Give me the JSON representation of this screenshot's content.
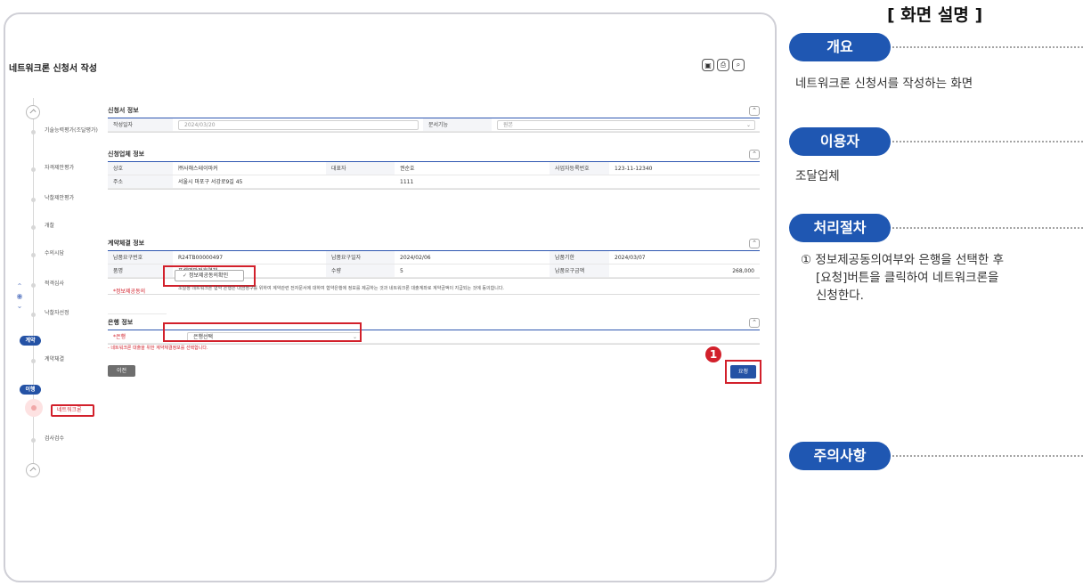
{
  "panel": {
    "title": "[ 화면 설명 ]",
    "overview_label": "개요",
    "overview_text": "네트워크론 신청서를 작성하는 화면",
    "user_label": "이용자",
    "user_text": "조달업체",
    "procedure_label": "처리절차",
    "procedure_line1": "① 정보제공동의여부와 은행을 선택한 후",
    "procedure_line2": "[요청]버튼을 클릭하여 네트워크론을",
    "procedure_line3": "신청한다.",
    "caution_label": "주의사항"
  },
  "screen": {
    "title": "네트워크론 신청서 작성",
    "toolbar_icons": [
      "save-icon",
      "print-icon",
      "zoom-icon"
    ],
    "steps": [
      {
        "label": "기술능력평가(조달평가)"
      },
      {
        "label": "자격제안평가"
      },
      {
        "label": "낙찰제안평가"
      },
      {
        "label": "개찰"
      },
      {
        "label": "수의시담"
      },
      {
        "label": "적격심사"
      },
      {
        "label": "낙찰자선정"
      },
      {
        "label": "계약체결"
      },
      {
        "label": "네트워크론"
      },
      {
        "label": "검사검수"
      }
    ],
    "stages": {
      "contract": "계약",
      "performance": "이행"
    },
    "application": {
      "header": "신청서 정보",
      "date_label": "작성일자",
      "date_value": "2024/03/20",
      "doc_label": "문서기능",
      "doc_value": "원본"
    },
    "company": {
      "header": "신청업체 정보",
      "name_label": "상호",
      "name_value": "㈜사해스테이마커",
      "rep_label": "대표자",
      "rep_value": "권순호",
      "bizno_label": "사업자등록번호",
      "bizno_value": "123-11-12340",
      "addr_label": "주소",
      "addr_value": "서울시 마포구 서강로9길 45",
      "addr_detail": "1111"
    },
    "contract": {
      "header": "계약체결 정보",
      "reqno_label": "납품요구번호",
      "reqno_value": "R24TB00000497",
      "reqdate_label": "납품요구일자",
      "reqdate_value": "2024/02/06",
      "deadline_label": "납품기한",
      "deadline_value": "2024/03/07",
      "item_label": "품명",
      "item_value": "포셀명판정후열체",
      "qty_label": "수량",
      "qty_value": "5",
      "amount_label": "납품요구금액",
      "amount_value": "268,000",
      "consent_label": "*정보제공동의",
      "consent_btn": "정보제공동의확인",
      "consent_text": "조달청 네트워크론 협약 은행은 대금청구를 위하여 계약관련 전자문서에 대하여 협약은행에 정보를 제공하는 것과 네트워크론 대출계좌로 계약금액이 지급되는 것에 동의합니다."
    },
    "bank": {
      "header": "은행 정보",
      "bank_label": "*은행",
      "bank_value": "은행선택",
      "notice": "- 네트워크론 대출을 위한 계약체결정보를 선택합니다."
    },
    "buttons": {
      "prev": "이전",
      "request": "요청"
    },
    "callout": "1"
  }
}
